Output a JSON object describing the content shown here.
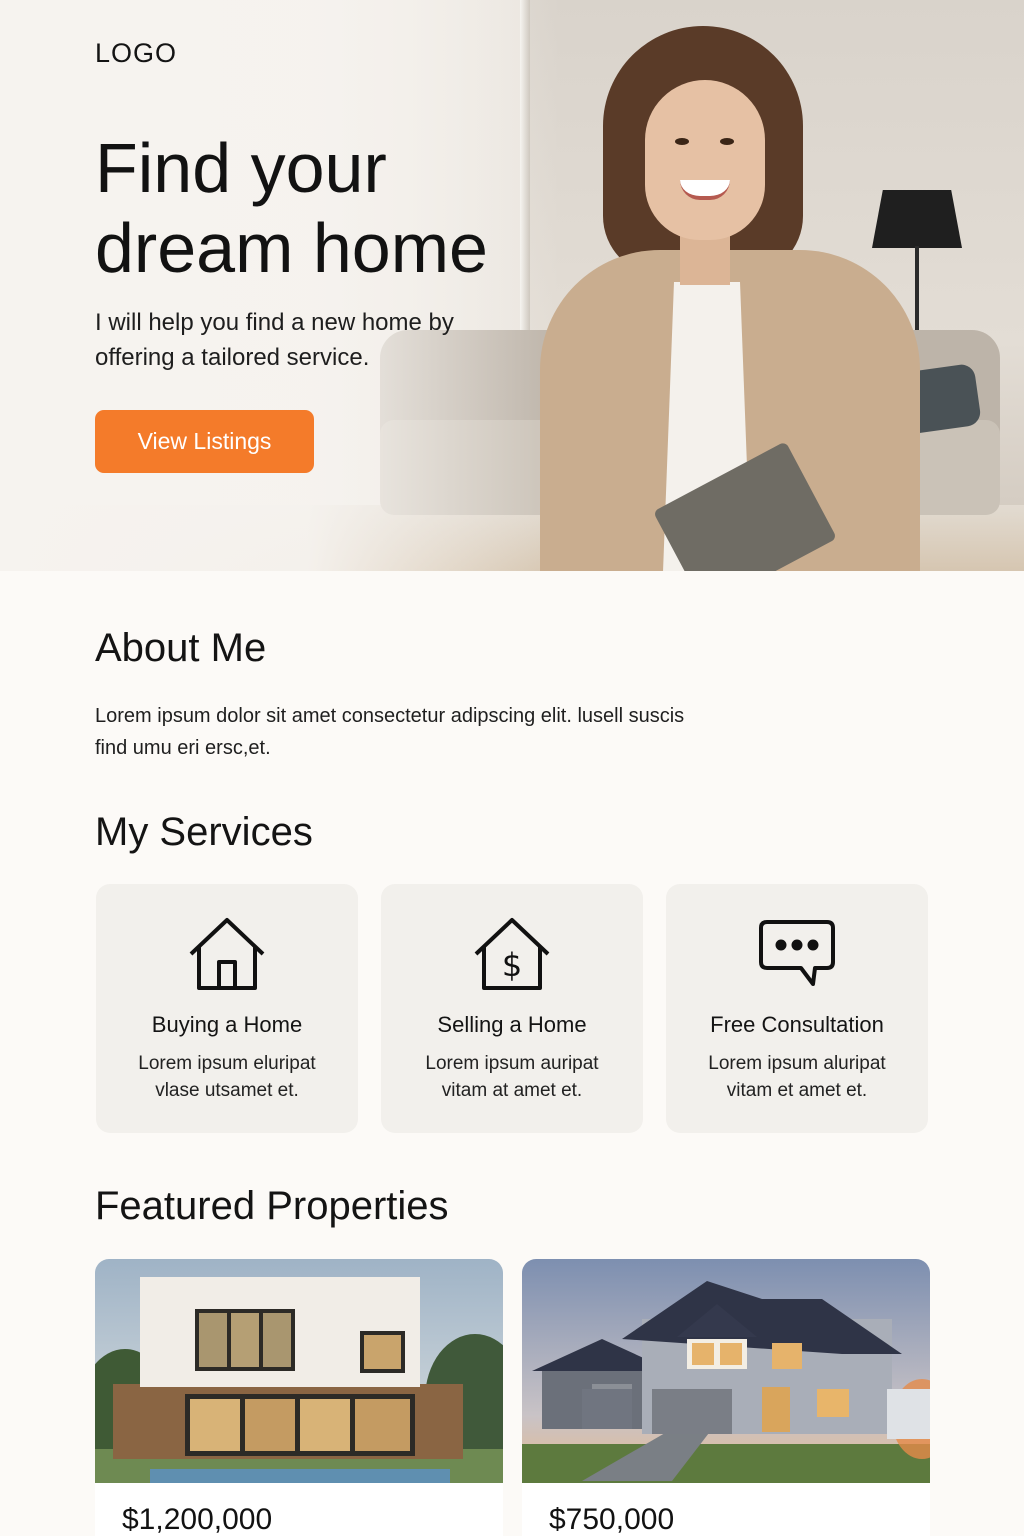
{
  "header": {
    "logo": "LOGO"
  },
  "hero": {
    "title": "Find your dream home",
    "subtitle": "I will help you find a new home by offering a tailored service.",
    "cta_label": "View Listings"
  },
  "about": {
    "heading": "About Me",
    "text": "Lorem ipsum dolor sit amet consectetur adipscing elit. lusell suscis find umu eri ersc,et."
  },
  "services": {
    "heading": "My Services",
    "items": [
      {
        "icon": "house-icon",
        "title": "Buying a Home",
        "description": "Lorem ipsum eluripat vlase utsamet et."
      },
      {
        "icon": "house-dollar-icon",
        "title": "Selling a Home",
        "description": "Lorem ipsum auripat vitam at amet et."
      },
      {
        "icon": "chat-bubble-icon",
        "title": "Free Consultation",
        "description": "Lorem ipsum aluripat vitam et amet et."
      }
    ]
  },
  "featured": {
    "heading": "Featured Properties",
    "properties": [
      {
        "price": "$1,200,000"
      },
      {
        "price": "$750,000"
      }
    ]
  },
  "colors": {
    "accent": "#f47b2a",
    "background": "#fcfaf7",
    "card": "#f2f0ec"
  }
}
